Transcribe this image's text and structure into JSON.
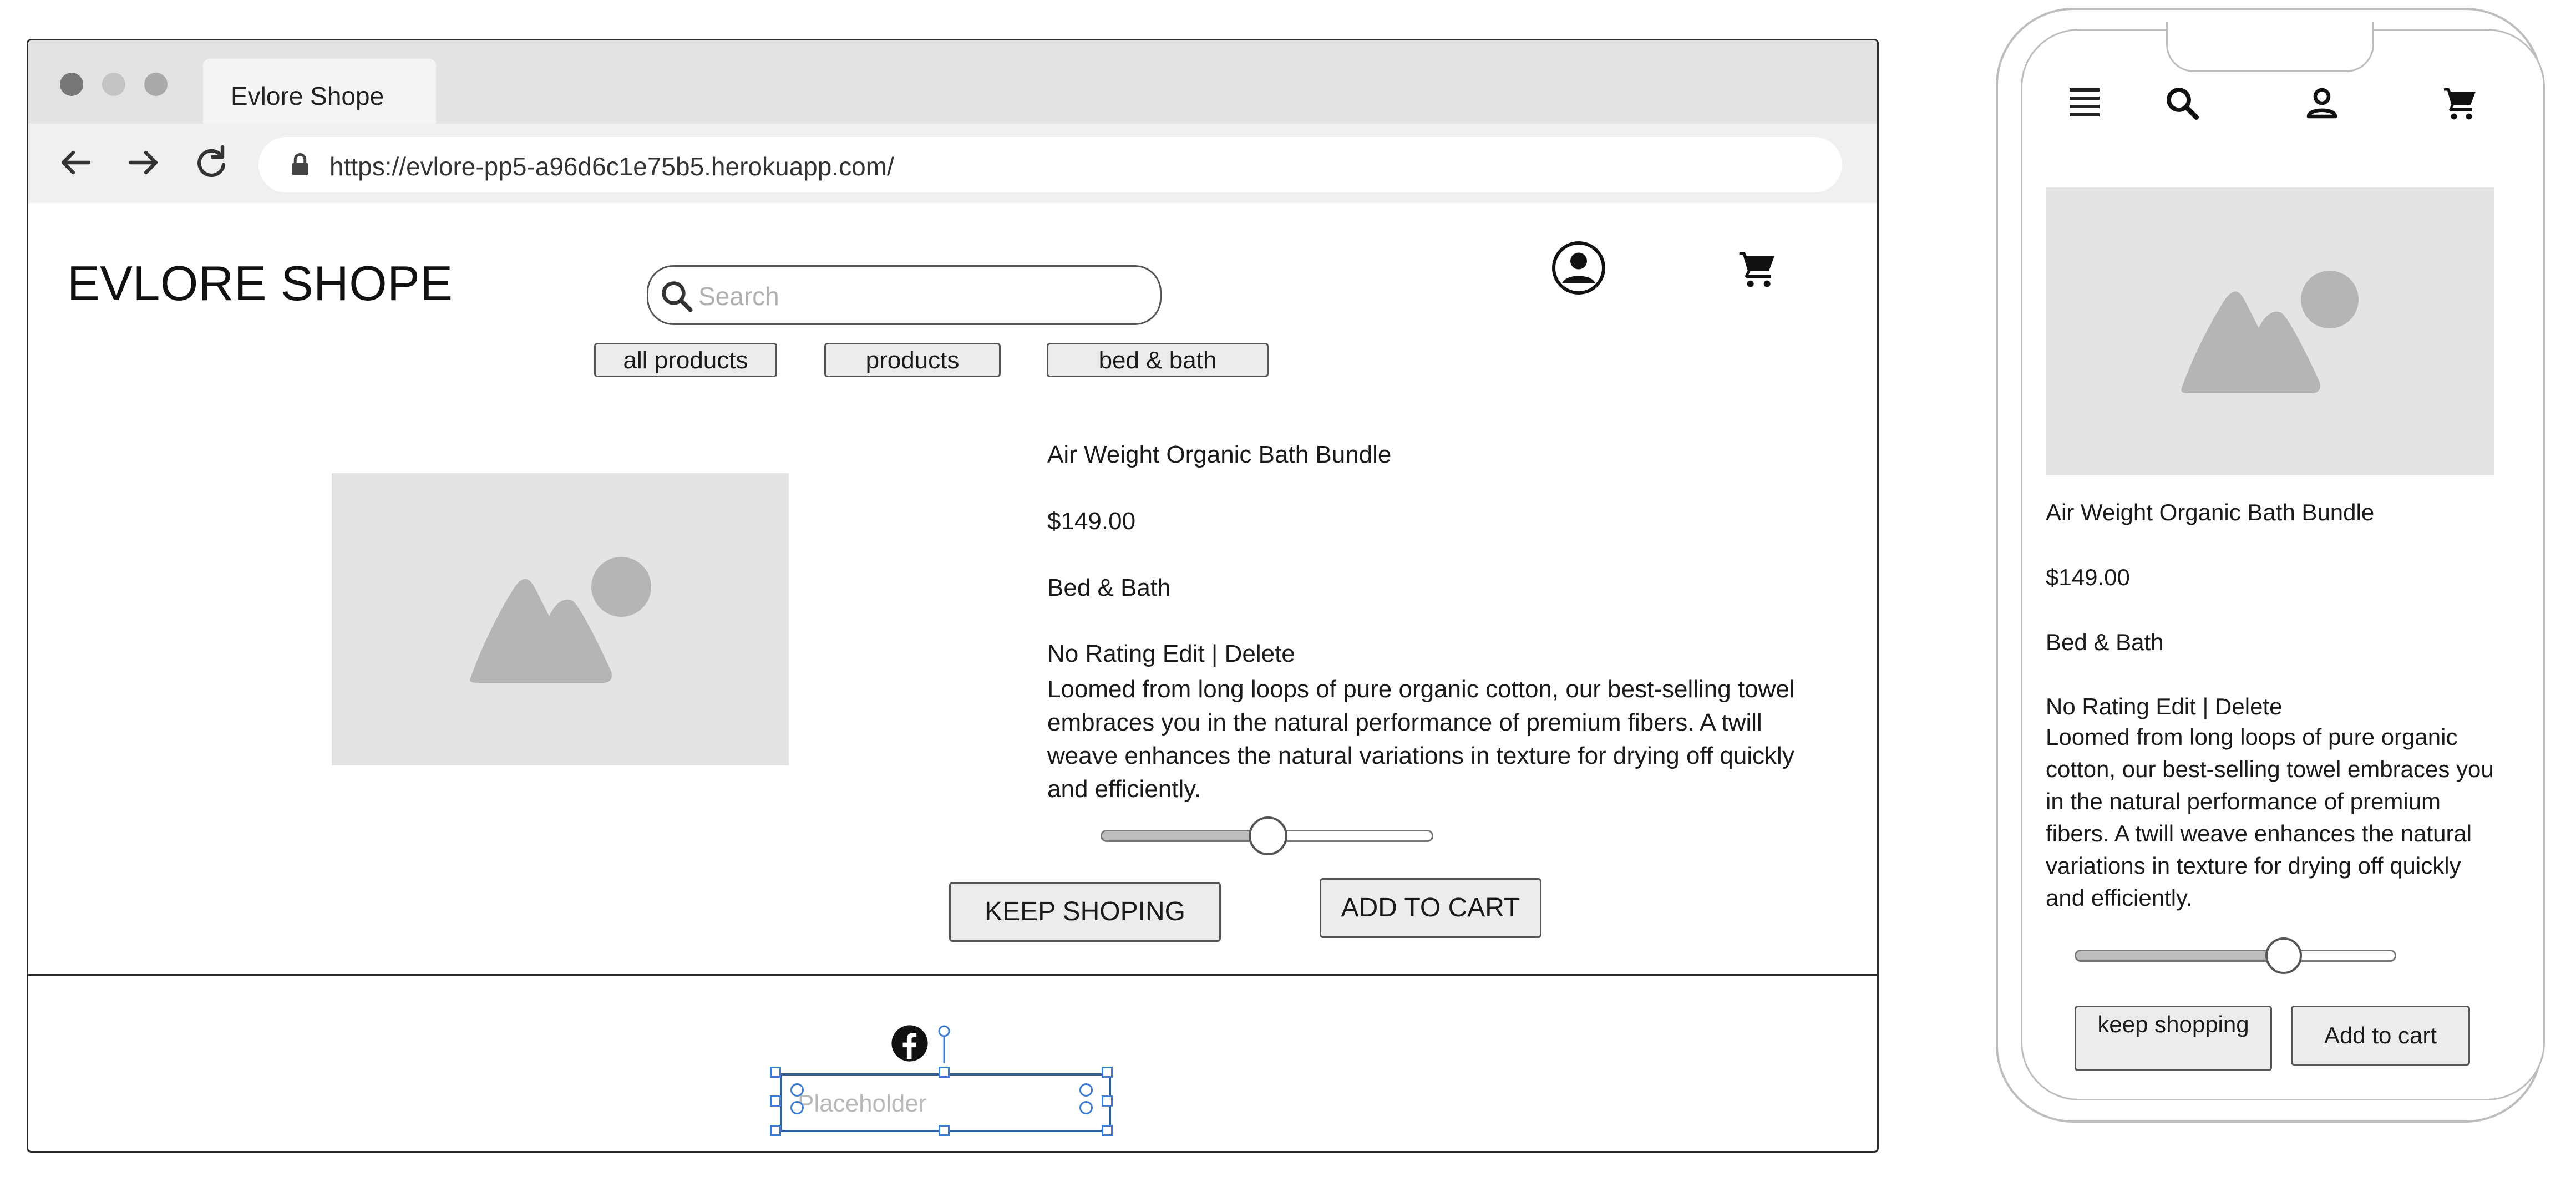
{
  "browser": {
    "tab_title": "Evlore Shope",
    "url": "https://evlore-pp5-a96d6c1e75b5.herokuapp.com/",
    "window_dots": [
      "close-dot",
      "minimize-dot",
      "maximize-dot"
    ]
  },
  "header": {
    "site_title": "EVLORE SHOPE",
    "search_placeholder": "Search",
    "icons": [
      "account-icon",
      "cart-icon"
    ]
  },
  "categories": [
    "all products",
    "products",
    "bed & bath"
  ],
  "product": {
    "name": "Air Weight Organic Bath Bundle",
    "price": "$149.00",
    "category": "Bed & Bath",
    "rating_actions": "No Rating Edit | Delete",
    "description": "Loomed from long loops of pure organic cotton, our best-selling towel embraces you in the natural performance of premium fibers. A twill weave enhances the natural variations in texture for drying off quickly and efficiently.",
    "quantity_slider_level": 0.5
  },
  "actions": {
    "keep_shopping": "KEEP SHOPING",
    "add_to_cart": "ADD TO CART"
  },
  "footer": {
    "social_icon": "facebook-icon",
    "placeholder": "Placeholder"
  },
  "mobile": {
    "nav_icons": [
      "menu-icon",
      "search-icon",
      "account-icon",
      "cart-icon"
    ],
    "quantity_slider_level": 0.62,
    "keep_shopping": "keep shopping",
    "add_to_cart": "Add to cart"
  },
  "colors": {
    "tab_bar": "#e3e3e3",
    "image_placeholder": "#e4e4e4",
    "selection_blue": "#3d7bd0"
  }
}
